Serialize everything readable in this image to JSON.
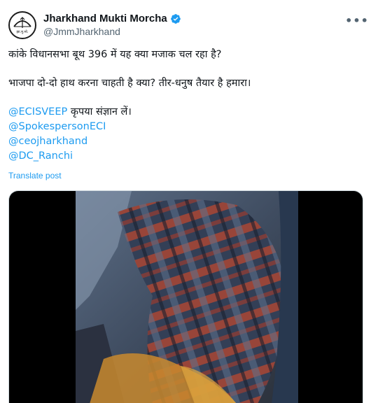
{
  "author": {
    "display_name": "Jharkhand Mukti Morcha",
    "handle": "@JmmJharkhand",
    "verified": true,
    "avatar_icon": "jmm-bow-arrow-logo",
    "verified_color": "#1d9bf0"
  },
  "more_icon": "more-horizontal-icon",
  "more_label": "•••",
  "post": {
    "line1": "कांके विधानसभा बूथ 396 में यह क्या मजाक चल रहा है?",
    "line2": "भाजपा दो-दो हाथ करना चाहती है क्या? तीर-धनुष तैयार है हमारा।",
    "mention1": "@ECISVEEP",
    "mention1_suffix": " कृपया संज्ञान लें।",
    "mention2": "@SpokespersonECI",
    "mention3": "@ceojharkhand",
    "mention4": "@DC_Ranchi"
  },
  "translate_label": "Translate post",
  "media": {
    "type": "video-thumbnail",
    "accent_red": "#c8533e",
    "accent_blue": "#6b86a8"
  },
  "colors": {
    "link": "#1d9bf0",
    "secondary_text": "#536471",
    "primary_text": "#0f1419"
  }
}
